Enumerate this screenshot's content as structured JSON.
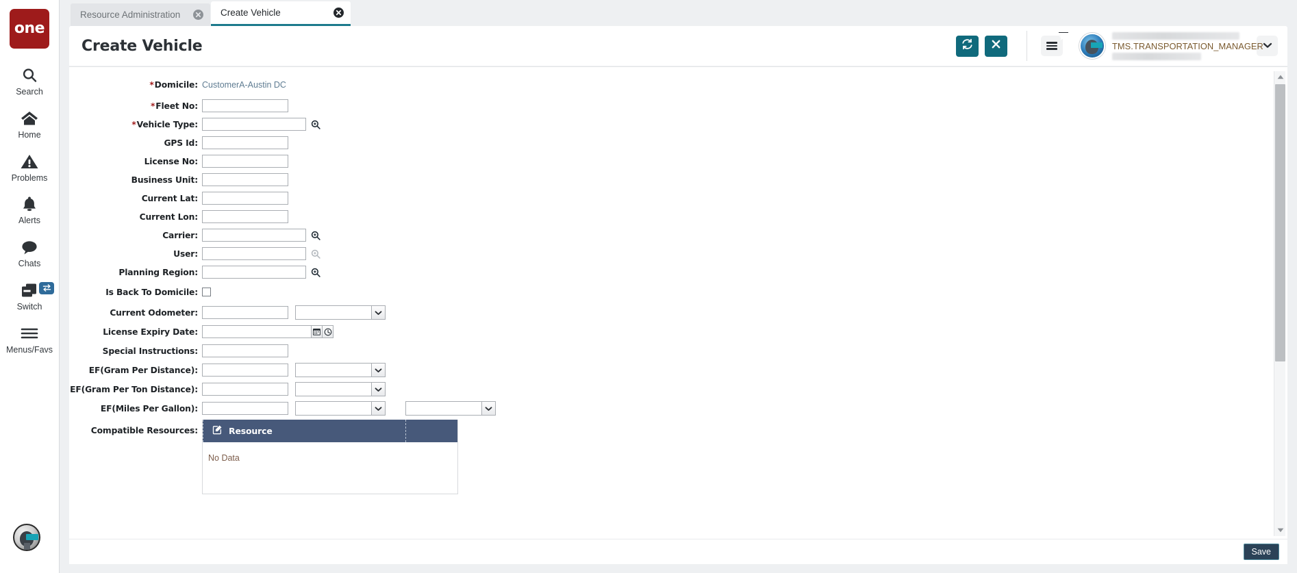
{
  "brand": {
    "logo_text": "one"
  },
  "sidebar": {
    "items": [
      {
        "label": "Search",
        "icon": "search-icon"
      },
      {
        "label": "Home",
        "icon": "home-icon"
      },
      {
        "label": "Problems",
        "icon": "warning-triangle-icon"
      },
      {
        "label": "Alerts",
        "icon": "bell-icon"
      },
      {
        "label": "Chats",
        "icon": "chat-bubble-icon"
      },
      {
        "label": "Switch",
        "icon": "stacked-cards-icon",
        "badge_icon": "swap-arrows-icon"
      },
      {
        "label": "Menus/Favs",
        "icon": "hamburger-icon"
      }
    ]
  },
  "tabs": [
    {
      "label": "Resource Administration",
      "active": false
    },
    {
      "label": "Create Vehicle",
      "active": true
    }
  ],
  "header": {
    "title": "Create Vehicle",
    "refresh_icon": "refresh-icon",
    "close_icon": "close-x-icon",
    "menu_icon": "hamburger-icon",
    "badge_icon": "star-icon",
    "avatar_icon": "user-avatar",
    "user_name": "TMS.TRANSPORTATION_MANAGER",
    "caret_icon": "chevron-down-icon",
    "accent_teal": "#106a7c",
    "badge_red": "#c62828"
  },
  "form": {
    "fields": [
      {
        "label": "Domicile",
        "required": true,
        "type": "link",
        "value": "CustomerA-Austin DC"
      },
      {
        "label": "Fleet No",
        "required": true,
        "type": "text",
        "value": ""
      },
      {
        "label": "Vehicle Type",
        "required": true,
        "type": "text-lookup",
        "value": ""
      },
      {
        "label": "GPS Id",
        "required": false,
        "type": "text",
        "value": ""
      },
      {
        "label": "License No",
        "required": false,
        "type": "text",
        "value": ""
      },
      {
        "label": "Business Unit",
        "required": false,
        "type": "text",
        "value": ""
      },
      {
        "label": "Current Lat",
        "required": false,
        "type": "text",
        "value": ""
      },
      {
        "label": "Current Lon",
        "required": false,
        "type": "text",
        "value": ""
      },
      {
        "label": "Carrier",
        "required": false,
        "type": "text-lookup",
        "value": ""
      },
      {
        "label": "User",
        "required": false,
        "type": "text-lookup-disabled",
        "value": ""
      },
      {
        "label": "Planning Region",
        "required": false,
        "type": "text-lookup",
        "value": ""
      },
      {
        "label": "Is Back To Domicile",
        "required": false,
        "type": "checkbox",
        "checked": false
      },
      {
        "label": "Current Odometer",
        "required": false,
        "type": "text-select",
        "value": "",
        "select_value": ""
      },
      {
        "label": "License Expiry Date",
        "required": false,
        "type": "datetime",
        "value": ""
      },
      {
        "label": "Special Instructions",
        "required": false,
        "type": "text",
        "value": ""
      },
      {
        "label": "EF(Gram Per Distance)",
        "required": false,
        "type": "text-select",
        "value": "",
        "select_value": ""
      },
      {
        "label": "EF(Gram Per Ton Distance)",
        "required": false,
        "type": "text-select",
        "value": "",
        "select_value": ""
      },
      {
        "label": "EF(Miles Per Gallon)",
        "required": false,
        "type": "text-select-select",
        "value": "",
        "select_value": "",
        "select2_value": ""
      },
      {
        "label": "Compatible Resources",
        "required": false,
        "type": "grid"
      }
    ],
    "grid": {
      "edit_icon": "edit-pencil-icon",
      "column": "Resource",
      "empty_text": "No Data",
      "header_color": "#47597a"
    }
  },
  "footer": {
    "save_label": "Save",
    "save_color": "#2b4257"
  }
}
